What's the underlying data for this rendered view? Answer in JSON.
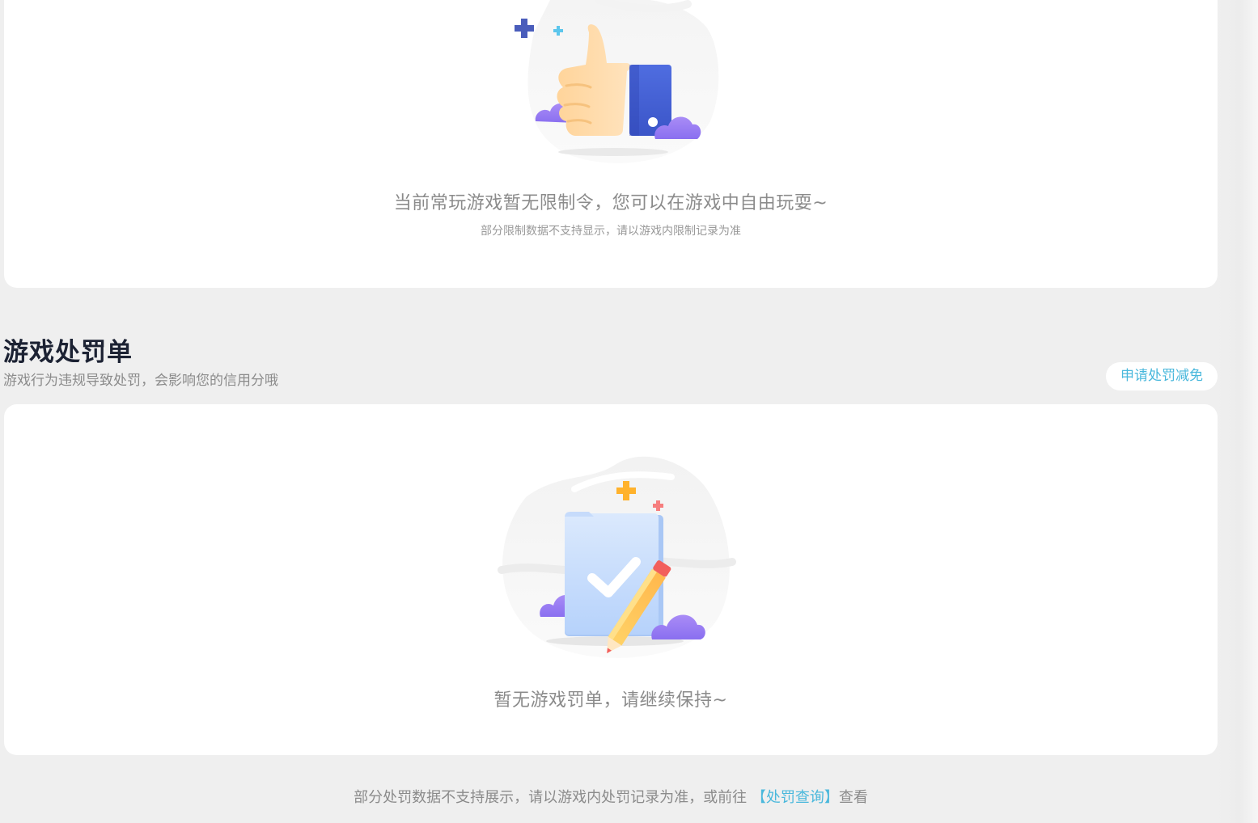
{
  "restriction_card": {
    "empty_title": "当前常玩游戏暂无限制令，您可以在游戏中自由玩耍~",
    "empty_note": "部分限制数据不支持显示，请以游戏内限制记录为准"
  },
  "penalty_section": {
    "title": "游戏处罚单",
    "description": "游戏行为违规导致处罚，会影响您的信用分哦",
    "apply_button": "申请处罚减免",
    "empty_title": "暂无游戏罚单，请继续保持~"
  },
  "footer": {
    "note_before": "部分处罚数据不支持展示，请以游戏内处罚记录为准，或前往 ",
    "link": "【处罚查询】",
    "note_after": "查看"
  },
  "colors": {
    "background": "#efefef",
    "card": "#ffffff",
    "accent": "#4ab8dc",
    "title": "#1c2233",
    "muted_text": "#8b8b8b"
  },
  "icons": {
    "top_illustration": "thumbs-up-illustration",
    "bottom_illustration": "clipboard-check-pencil-illustration"
  }
}
